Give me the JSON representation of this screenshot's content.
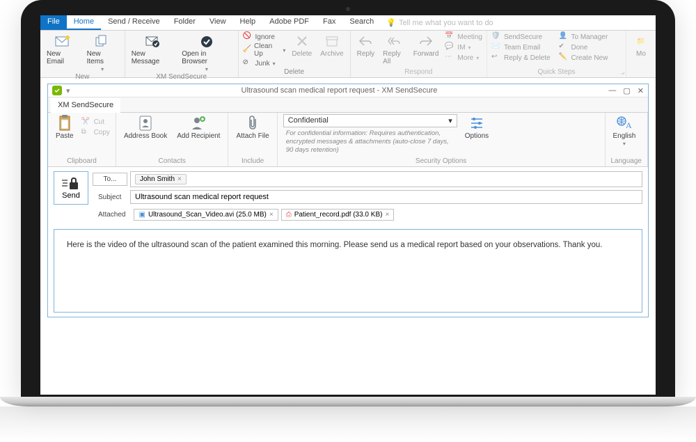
{
  "main_tabs": {
    "file": "File",
    "home": "Home",
    "send_receive": "Send / Receive",
    "folder": "Folder",
    "view": "View",
    "help": "Help",
    "adobe_pdf": "Adobe PDF",
    "fax": "Fax",
    "search": "Search",
    "tell_me": "Tell me what you want to do"
  },
  "ribbon": {
    "new": {
      "label": "New",
      "new_email": "New Email",
      "new_items": "New Items"
    },
    "xm": {
      "label": "XM SendSecure",
      "new_message": "New Message",
      "open_in_browser": "Open in Browser"
    },
    "delete": {
      "label": "Delete",
      "ignore": "Ignore",
      "clean_up": "Clean Up",
      "junk": "Junk",
      "delete_btn": "Delete",
      "archive": "Archive"
    },
    "respond": {
      "label": "Respond",
      "reply": "Reply",
      "reply_all": "Reply All",
      "forward": "Forward",
      "meeting": "Meeting",
      "im": "IM",
      "more": "More"
    },
    "quick_steps": {
      "label": "Quick Steps",
      "sendsecure": "SendSecure",
      "team_email": "Team Email",
      "reply_delete": "Reply & Delete",
      "to_manager": "To Manager",
      "done": "Done",
      "create_new": "Create New"
    },
    "move_trunc": "Mo"
  },
  "compose": {
    "window_title": "Ultrasound scan medical report request - XM SendSecure",
    "tab_name": "XM SendSecure",
    "clipboard": {
      "label": "Clipboard",
      "paste": "Paste",
      "cut": "Cut",
      "copy": "Copy"
    },
    "contacts": {
      "label": "Contacts",
      "address_book": "Address Book",
      "add_recipient": "Add Recipient"
    },
    "include": {
      "label": "Include",
      "attach_file": "Attach File"
    },
    "security": {
      "label": "Security Options",
      "profile": "Confidential",
      "desc": "For confidential information: Requires authentication, encrypted messages & attachments (auto-close 7 days, 90 days retention)",
      "options": "Options"
    },
    "language": {
      "label": "Language",
      "english": "English"
    },
    "send": "Send",
    "to_label": "To...",
    "subject_label": "Subject",
    "attached_label": "Attached",
    "recipient": "John Smith",
    "subject_value": "Ultrasound scan medical report request",
    "attachments": [
      {
        "name": "Ultrasound_Scan_Video.avi (25.0 MB)",
        "icon": "video"
      },
      {
        "name": "Patient_record.pdf (33.0 KB)",
        "icon": "pdf"
      }
    ],
    "body": "Here is the video of the ultrasound scan of the patient examined this morning.  Please send us a medical report based on your observations.  Thank you."
  }
}
